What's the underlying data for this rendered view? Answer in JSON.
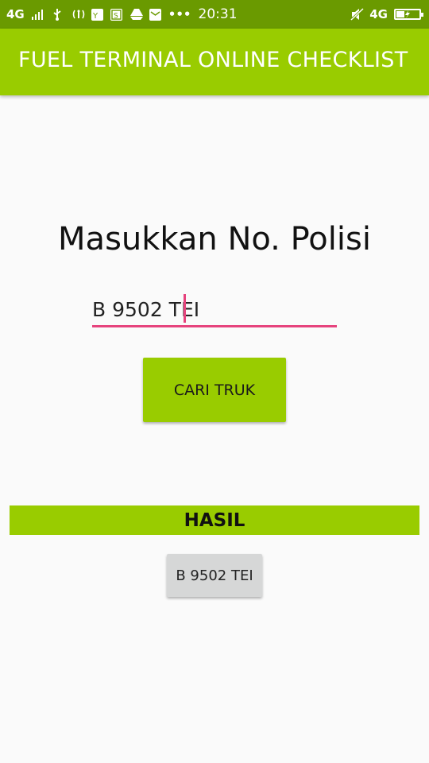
{
  "status_bar": {
    "network_left": "4G",
    "more": "•••",
    "time": "20:31",
    "network_right": "4G",
    "icons_left": [
      "signal-icon",
      "usb-icon",
      "hotspot-icon",
      "app-icon-1",
      "app-icon-s",
      "drive-icon",
      "mail-icon"
    ],
    "icons_right": [
      "mute-icon",
      "signal-4g-icon",
      "battery-charging-icon"
    ]
  },
  "app_bar": {
    "title": "FUEL TERMINAL ONLINE CHECKLIST"
  },
  "main": {
    "heading": "Masukkan No. Polisi",
    "plate_input_value": "B 9502 TEI",
    "search_button_label": "CARI TRUK",
    "result_header": "HASIL",
    "result_item_label": "B 9502 TEI"
  },
  "colors": {
    "status_bar_bg": "#6a9a00",
    "accent_green": "#99cc00",
    "input_underline": "#e6437d",
    "background": "#fafafa",
    "result_button_bg": "#d6d7d7"
  }
}
